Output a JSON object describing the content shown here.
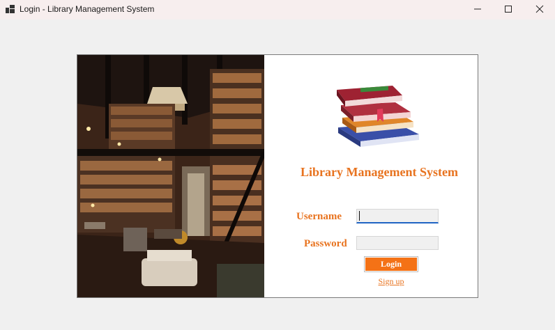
{
  "window": {
    "title": "Login - Library Management System",
    "icons": {
      "app": "app-icon",
      "minimize": "minimize-icon",
      "maximize": "maximize-icon",
      "close": "close-icon"
    }
  },
  "panel": {
    "title": "Library Management System",
    "username_label": "Username",
    "password_label": "Password",
    "username_value": "",
    "password_value": "",
    "login_label": "Login",
    "signup_label": "Sign up",
    "images": {
      "photo": "library-interior-photo",
      "logo": "stacked-books-logo"
    }
  },
  "colors": {
    "accent": "#e8731f",
    "button": "#f47216",
    "focus": "#1f64c4",
    "titlebar": "#f7eeee",
    "background": "#f0f0f0"
  }
}
